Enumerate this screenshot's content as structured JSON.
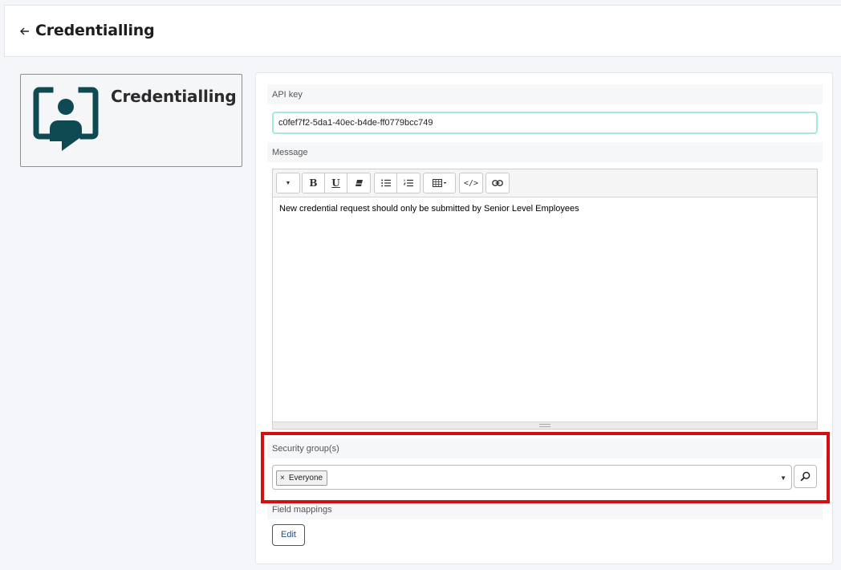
{
  "header": {
    "title": "Credentialling",
    "back_icon": "arrow-left-icon"
  },
  "app_card": {
    "name": "Credentialling",
    "logo_icon": "credentialling-logo-icon",
    "logo_color": "#0f4a52"
  },
  "form": {
    "api_key": {
      "label": "API key",
      "value": "c0fef7f2-5da1-40ec-b4de-ff0779bcc749"
    },
    "message": {
      "label": "Message",
      "toolbar": {
        "items": [
          "style-dropdown",
          "bold",
          "underline",
          "eraser",
          "bullet-list",
          "numbered-list",
          "table",
          "code-view",
          "link"
        ],
        "bold_label": "B",
        "underline_label": "U",
        "code_label": "</>"
      },
      "content": "New credential request should only be submitted by Senior Level Employees"
    },
    "security_groups": {
      "label": "Security group(s)",
      "tags": [
        {
          "label": "Everyone",
          "remove": "×"
        }
      ]
    },
    "field_mappings": {
      "label": "Field mappings",
      "edit_label": "Edit"
    }
  },
  "colors": {
    "accent": "#1f4e82",
    "highlight": "#d40f0f",
    "focus_border": "#a7e8de"
  }
}
